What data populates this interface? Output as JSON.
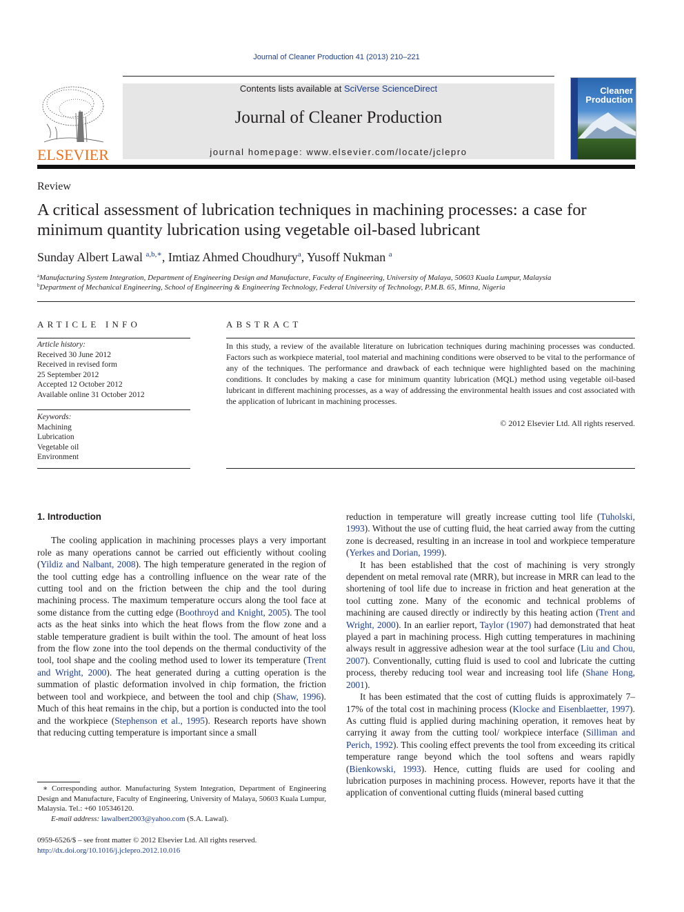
{
  "running_head": "Journal of Cleaner Production 41 (2013) 210–221",
  "publisher": {
    "logo_icon": "elsevier-tree-icon",
    "name": "ELSEVIER",
    "brand_color": "#e9711c"
  },
  "header": {
    "contents_prefix": "Contents lists available at ",
    "contents_link": "SciVerse ScienceDirect",
    "journal_name": "Journal of Cleaner Production",
    "homepage": "journal homepage: www.elsevier.com/locate/jclepro",
    "box_color": "#e6e6e6"
  },
  "cover": {
    "line1": "Cleaner",
    "line2": "Production"
  },
  "article": {
    "type": "Review",
    "title": "A critical assessment of lubrication techniques in machining processes: a case for minimum quantity lubrication using vegetable oil-based lubricant",
    "authors": [
      {
        "name": "Sunday Albert Lawal",
        "sup": "a,b,∗"
      },
      {
        "name": "Imtiaz Ahmed Choudhury",
        "sup": "a"
      },
      {
        "name": "Yusoff Nukman",
        "sup": "a"
      }
    ],
    "affiliations": [
      {
        "mark": "a",
        "text": "Manufacturing System Integration, Department of Engineering Design and Manufacture, Faculty of Engineering, University of Malaya, 50603 Kuala Lumpur, Malaysia"
      },
      {
        "mark": "b",
        "text": "Department of Mechanical Engineering, School of Engineering & Engineering Technology, Federal University of Technology, P.M.B. 65, Minna, Nigeria"
      }
    ]
  },
  "article_info": {
    "heading": "ARTICLE INFO",
    "history_label": "Article history:",
    "history": [
      "Received 30 June 2012",
      "Received in revised form",
      "25 September 2012",
      "Accepted 12 October 2012",
      "Available online 31 October 2012"
    ],
    "keywords_label": "Keywords:",
    "keywords": [
      "Machining",
      "Lubrication",
      "Vegetable oil",
      "Environment"
    ]
  },
  "abstract": {
    "heading": "ABSTRACT",
    "text": "In this study, a review of the available literature on lubrication techniques during machining processes was conducted. Factors such as workpiece material, tool material and machining conditions were observed to be vital to the performance of any of the techniques. The performance and drawback of each technique were highlighted based on the machining conditions. It concludes by making a case for minimum quantity lubrication (MQL) method using vegetable oil-based lubricant in different machining processes, as a way of addressing the environmental health issues and cost associated with the application of lubricant in machining processes.",
    "copyright": "© 2012 Elsevier Ltd. All rights reserved."
  },
  "intro": {
    "heading": "1.  Introduction",
    "p1": [
      {
        "t": "The cooling application in machining processes plays a very important role as many operations cannot be carried out efficiently without cooling ("
      },
      {
        "t": "Yildiz and Nalbant, 2008",
        "link": true
      },
      {
        "t": "). The high temperature generated in the region of the tool cutting edge has a controlling influence on the wear rate of the cutting tool and on the friction between the chip and the tool during machining process. The maximum temperature occurs along the tool face at some distance from the cutting edge ("
      },
      {
        "t": "Boothroyd and Knight, 2005",
        "link": true
      },
      {
        "t": "). The tool acts as the heat sinks into which the heat flows from the flow zone and a stable temperature gradient is built within the tool. The amount of heat loss from the flow zone into the tool depends on the thermal conductivity of the tool, tool shape and the cooling method used to lower its temperature ("
      },
      {
        "t": "Trent and Wright, 2000",
        "link": true
      },
      {
        "t": "). The heat generated during a cutting operation is the summation of plastic deformation involved in chip formation, the friction between tool and workpiece, and between the tool and chip ("
      },
      {
        "t": "Shaw, 1996",
        "link": true
      },
      {
        "t": "). Much of this heat remains in the chip, but a portion is conducted into the tool and the workpiece ("
      },
      {
        "t": "Stephenson et al., 1995",
        "link": true
      },
      {
        "t": "). Research reports have shown that reducing cutting temperature is important since a small reduction in temperature will greatly increase cutting tool life ("
      },
      {
        "t": "Tuholski, 1993",
        "link": true
      },
      {
        "t": "). Without the use of cutting fluid, the heat carried away from the cutting zone is decreased, resulting in an increase in tool and workpiece temperature ("
      },
      {
        "t": "Yerkes and Dorian, 1999",
        "link": true
      },
      {
        "t": ")."
      }
    ],
    "p2": [
      {
        "t": "It has been established that the cost of machining is very strongly dependent on metal removal rate (MRR), but increase in MRR can lead to the shortening of tool life due to increase in friction and heat generation at the tool cutting zone. Many of the economic and technical problems of machining are caused directly or indirectly by this heating action ("
      },
      {
        "t": "Trent and Wright, 2000",
        "link": true
      },
      {
        "t": "). In an earlier report, "
      },
      {
        "t": "Taylor (1907)",
        "link": true
      },
      {
        "t": " had demonstrated that heat played a part in machining process. High cutting temperatures in machining always result in aggressive adhesion wear at the tool surface ("
      },
      {
        "t": "Liu and Chou, 2007",
        "link": true
      },
      {
        "t": "). Conventionally, cutting fluid is used to cool and lubricate the cutting process, thereby reducing tool wear and increasing tool life ("
      },
      {
        "t": "Shane Hong, 2001",
        "link": true
      },
      {
        "t": ")."
      }
    ],
    "p3": [
      {
        "t": "It has been estimated that the cost of cutting fluids is approximately 7–17% of the total cost in machining process ("
      },
      {
        "t": "Klocke and Eisenblaetter, 1997",
        "link": true
      },
      {
        "t": "). As cutting fluid is applied during machining operation, it removes heat by carrying it away from the cutting tool/ workpiece interface ("
      },
      {
        "t": "Silliman and Perich, 1992",
        "link": true
      },
      {
        "t": "). This cooling effect prevents the tool from exceeding its critical temperature range beyond which the tool softens and wears rapidly ("
      },
      {
        "t": "Bienkowski, 1993",
        "link": true
      },
      {
        "t": "). Hence, cutting fluids are used for cooling and lubrication purposes in machining process. However, reports have it that the application of conventional cutting fluids (mineral based cutting"
      }
    ]
  },
  "footnote": {
    "corresponding": "∗ Corresponding author. Manufacturing System Integration, Department of Engineering Design and Manufacture, Faculty of Engineering, University of Malaya, 50603 Kuala Lumpur, Malaysia. Tel.: +60 105346120.",
    "email_label": "E-mail address: ",
    "email": "lawalbert2003@yahoo.com",
    "email_suffix": " (S.A. Lawal)."
  },
  "issn_line": "0959-6526/$ – see front matter © 2012 Elsevier Ltd. All rights reserved.",
  "doi": "http://dx.doi.org/10.1016/j.jclepro.2012.10.016",
  "link_color": "#1a3c8c"
}
